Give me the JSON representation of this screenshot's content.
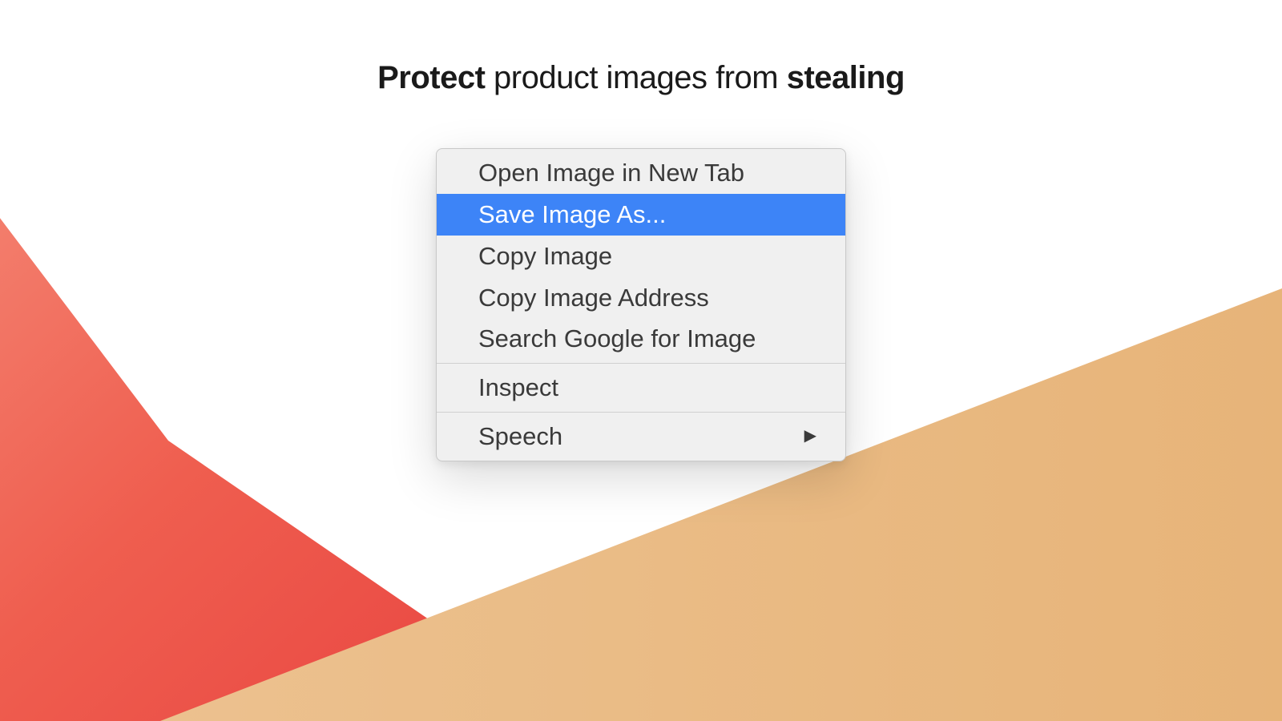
{
  "heading": {
    "word1": "Protect",
    "middle": " product images from ",
    "word2": "stealing"
  },
  "context_menu": {
    "sections": [
      {
        "items": [
          {
            "label": "Open Image in New Tab",
            "selected": false,
            "has_submenu": false
          },
          {
            "label": "Save Image As...",
            "selected": true,
            "has_submenu": false
          },
          {
            "label": "Copy Image",
            "selected": false,
            "has_submenu": false
          },
          {
            "label": "Copy Image Address",
            "selected": false,
            "has_submenu": false
          },
          {
            "label": "Search Google for Image",
            "selected": false,
            "has_submenu": false
          }
        ]
      },
      {
        "items": [
          {
            "label": "Inspect",
            "selected": false,
            "has_submenu": false
          }
        ]
      },
      {
        "items": [
          {
            "label": "Speech",
            "selected": false,
            "has_submenu": true
          }
        ]
      }
    ]
  },
  "colors": {
    "red_light": "#f47a6a",
    "red_dark": "#e8483e",
    "tan": "#e9bb82",
    "highlight": "#3d84f7"
  }
}
